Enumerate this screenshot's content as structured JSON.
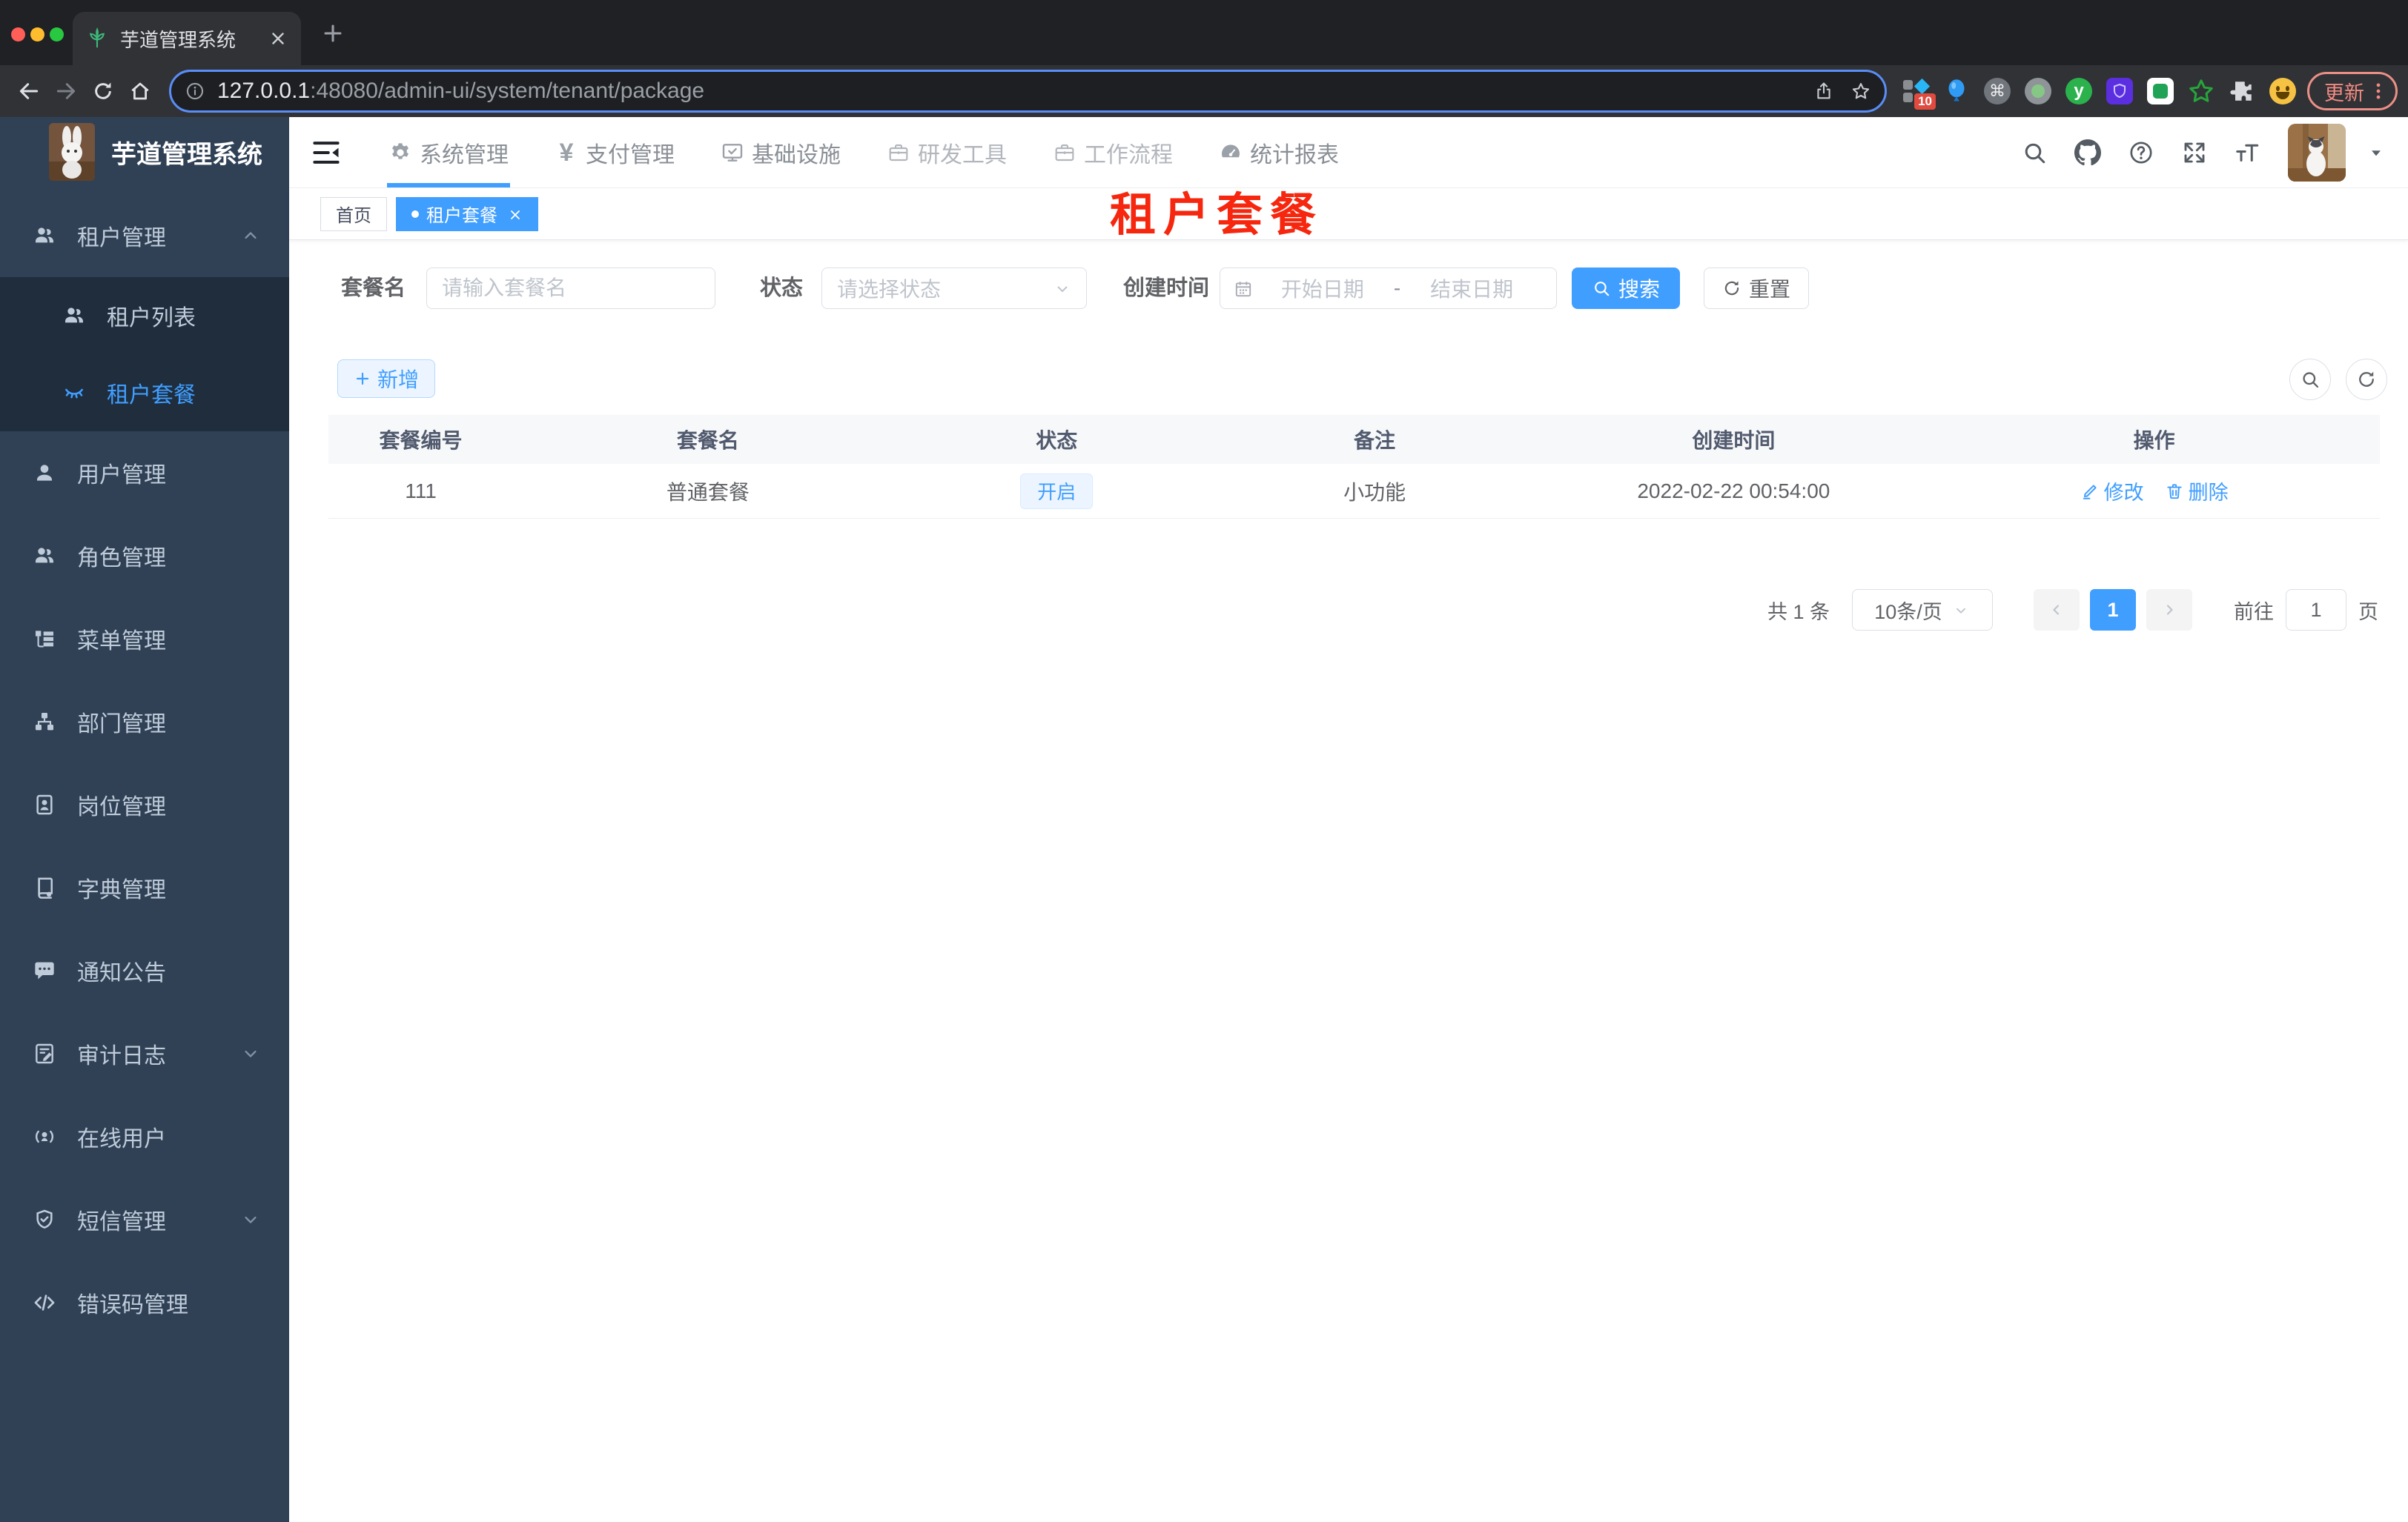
{
  "browser": {
    "tab_title": "芋道管理系统",
    "url_host": "127.0.0.1",
    "url_rest": ":48080/admin-ui/system/tenant/package",
    "ext_badge_count": "10",
    "update_button": "更新"
  },
  "app": {
    "logo_title": "芋道管理系统"
  },
  "topnav": {
    "items": [
      {
        "label": "系统管理",
        "icon": "gear-icon",
        "active": true
      },
      {
        "label": "支付管理",
        "icon": "yen-icon"
      },
      {
        "label": "基础设施",
        "icon": "monitor-icon"
      },
      {
        "label": "研发工具",
        "icon": "briefcase-icon"
      },
      {
        "label": "工作流程",
        "icon": "briefcase-icon"
      },
      {
        "label": "统计报表",
        "icon": "gauge-icon"
      }
    ]
  },
  "sidebar": {
    "items": [
      {
        "label": "租户管理",
        "icon": "users-icon",
        "state": "expanded"
      },
      {
        "label": "租户列表",
        "icon": "users-icon",
        "level": 2
      },
      {
        "label": "租户套餐",
        "icon": "package-icon",
        "level": 2,
        "active": true
      },
      {
        "label": "用户管理",
        "icon": "user-icon"
      },
      {
        "label": "角色管理",
        "icon": "users-icon"
      },
      {
        "label": "菜单管理",
        "icon": "menu-tree-icon"
      },
      {
        "label": "部门管理",
        "icon": "org-tree-icon"
      },
      {
        "label": "岗位管理",
        "icon": "post-card-icon"
      },
      {
        "label": "字典管理",
        "icon": "dict-book-icon"
      },
      {
        "label": "通知公告",
        "icon": "message-icon"
      },
      {
        "label": "审计日志",
        "icon": "log-icon",
        "state": "collapsed"
      },
      {
        "label": "在线用户",
        "icon": "online-icon"
      },
      {
        "label": "短信管理",
        "icon": "shield-icon",
        "state": "collapsed"
      },
      {
        "label": "错误码管理",
        "icon": "code-icon"
      }
    ]
  },
  "tags": {
    "home": "首页",
    "active": "租户套餐"
  },
  "annotation": {
    "text": "租户套餐",
    "color": "#f6270e"
  },
  "filter": {
    "name_label": "套餐名",
    "name_placeholder": "请输入套餐名",
    "status_label": "状态",
    "status_placeholder": "请选择状态",
    "date_label": "创建时间",
    "date_start_placeholder": "开始日期",
    "date_separator": "-",
    "date_end_placeholder": "结束日期",
    "search_label": "搜索",
    "reset_label": "重置"
  },
  "toolbar": {
    "add_label": "新增"
  },
  "table": {
    "headers": [
      "套餐编号",
      "套餐名",
      "状态",
      "备注",
      "创建时间",
      "操作"
    ],
    "rows": [
      {
        "id": "111",
        "name": "普通套餐",
        "status": "开启",
        "remark": "小功能",
        "created": "2022-02-22 00:54:00",
        "edit_label": "修改",
        "delete_label": "删除"
      }
    ]
  },
  "pagination": {
    "total": "共 1 条",
    "page_size": "10条/页",
    "current_page": "1",
    "goto_label": "前往",
    "goto_value": "1",
    "unit_label": "页"
  }
}
